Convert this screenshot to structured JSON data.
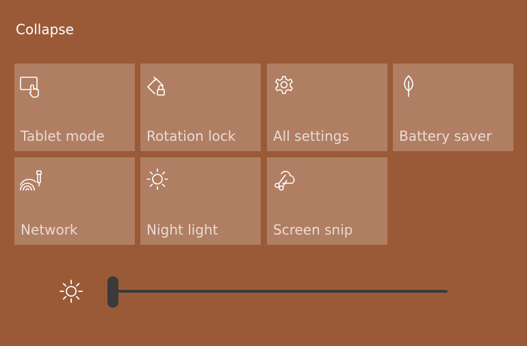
{
  "header": {
    "collapse_label": "Collapse"
  },
  "tiles": [
    {
      "label": "Tablet mode",
      "icon": "tablet-mode-icon"
    },
    {
      "label": "Rotation lock",
      "icon": "rotation-lock-icon"
    },
    {
      "label": "All settings",
      "icon": "gear-icon"
    },
    {
      "label": "Battery saver",
      "icon": "leaf-icon"
    },
    {
      "label": "Network",
      "icon": "network-icon"
    },
    {
      "label": "Night light",
      "icon": "night-light-icon"
    },
    {
      "label": "Screen snip",
      "icon": "scissors-icon"
    }
  ],
  "brightness": {
    "icon": "brightness-icon",
    "level": 0
  },
  "colors": {
    "background": "#9a5a38",
    "tile": "rgba(255,255,255,0.22)",
    "slider": "#3a3a3a"
  }
}
